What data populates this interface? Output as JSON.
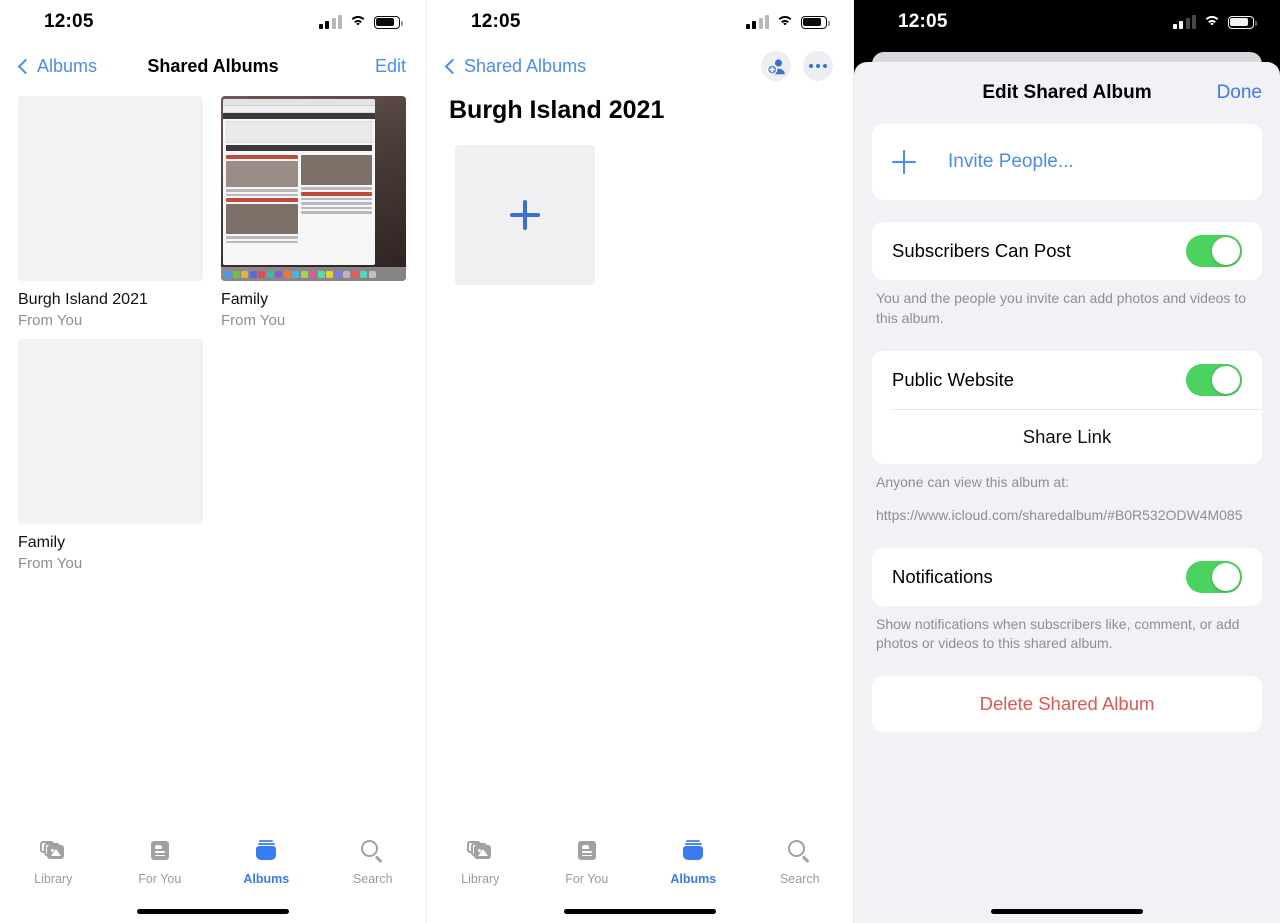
{
  "status_bar": {
    "time": "12:05",
    "signal_icon": "cellular-bars-icon",
    "wifi_icon": "wifi-icon",
    "battery_icon": "battery-icon"
  },
  "panel1": {
    "nav": {
      "back_label": "Albums",
      "back_icon": "chevron-left-icon",
      "title": "Shared Albums",
      "edit_label": "Edit"
    },
    "albums": [
      {
        "name": "Burgh Island 2021",
        "subtitle": "From You",
        "thumb": "placeholder"
      },
      {
        "name": "Family",
        "subtitle": "From You",
        "thumb": "screenshot"
      },
      {
        "name": "Family",
        "subtitle": "From You",
        "thumb": "placeholder"
      }
    ]
  },
  "panel2": {
    "nav": {
      "back_label": "Shared Albums",
      "back_icon": "chevron-left-icon",
      "add_people_icon": "add-person-icon",
      "more_icon": "ellipsis-icon"
    },
    "large_title": "Burgh Island 2021",
    "add_tile_icon": "plus-icon"
  },
  "panel3": {
    "sheet_title": "Edit Shared Album",
    "done_label": "Done",
    "invite": {
      "icon": "plus-icon",
      "label": "Invite People..."
    },
    "subscribers": {
      "label": "Subscribers Can Post",
      "toggle": "on",
      "footnote": "You and the people you invite can add photos and videos to this album."
    },
    "public_website": {
      "label": "Public Website",
      "toggle": "on",
      "share_link_label": "Share Link",
      "footnote": "Anyone can view this album at:",
      "url": "https://www.icloud.com/sharedalbum/#B0R532ODW4M085"
    },
    "notifications": {
      "label": "Notifications",
      "toggle": "on",
      "footnote": "Show notifications when subscribers like, comment, or add photos or videos to this shared album."
    },
    "delete_label": "Delete Shared Album"
  },
  "tabbar": {
    "tabs": [
      {
        "label": "Library",
        "icon": "photo-library-icon",
        "active": false
      },
      {
        "label": "For You",
        "icon": "for-you-card-icon",
        "active": false
      },
      {
        "label": "Albums",
        "icon": "albums-stack-icon",
        "active": true
      },
      {
        "label": "Search",
        "icon": "magnifier-icon",
        "active": false
      }
    ]
  },
  "colors": {
    "accent_blue": "#3a7bf0",
    "link_blue": "#4a8cf7",
    "toggle_green": "#4cd35f",
    "destructive_red": "#e0584f",
    "sheet_bg": "#f2f1f6"
  }
}
